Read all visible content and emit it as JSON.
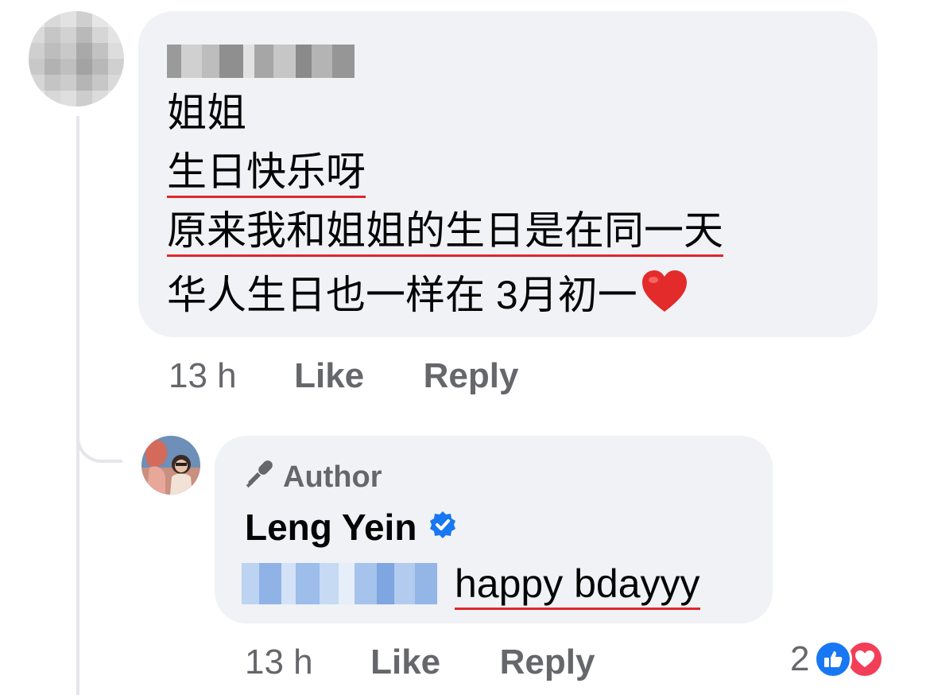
{
  "comment": {
    "lines": [
      "姐姐",
      "生日快乐呀",
      "原来我和姐姐的生日是在同一天",
      "华人生日也一样在 3月初一"
    ],
    "time": "13 h",
    "like_label": "Like",
    "reply_label": "Reply"
  },
  "reply": {
    "badge_label": "Author",
    "author_name": "Leng Yein",
    "text": "happy bdayyy",
    "time": "13 h",
    "like_label": "Like",
    "reply_label": "Reply",
    "reaction_count": "2"
  },
  "icons": {
    "heart": "red-heart-emoji-icon",
    "author_badge": "microphone-icon",
    "verified": "verified-badge-icon",
    "like_reaction": "like-reaction-icon",
    "love_reaction": "love-reaction-icon"
  },
  "colors": {
    "bubble": "#f0f2f5",
    "secondary_text": "#65676b",
    "underline": "#e0262c",
    "verified": "#1877f2",
    "love": "#f33e58"
  }
}
